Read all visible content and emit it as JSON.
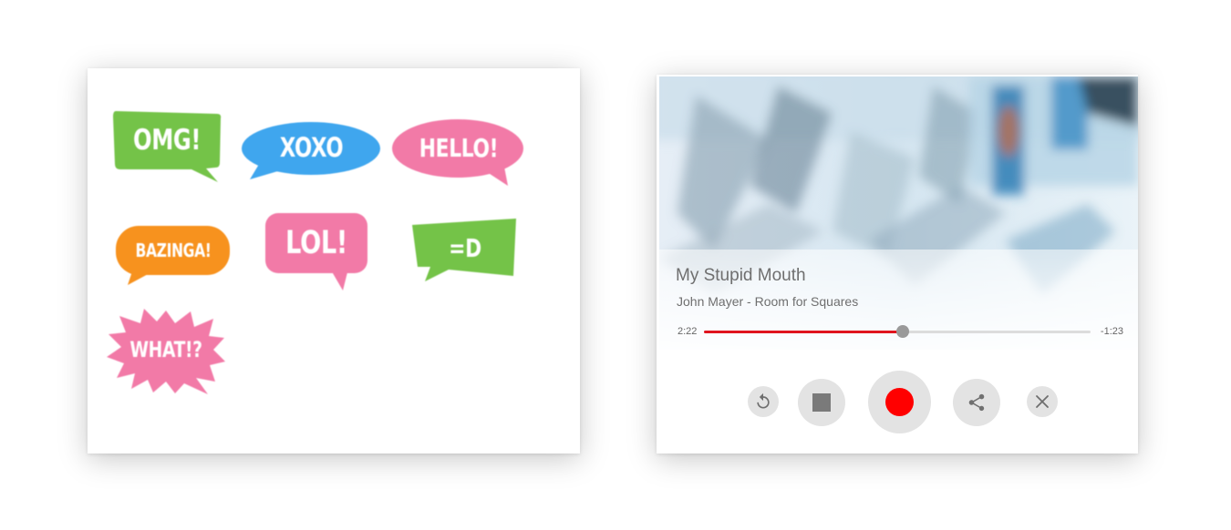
{
  "stickers": [
    {
      "label": "OMG!",
      "color": "#74c348"
    },
    {
      "label": "XOXO",
      "color": "#3fa6ee"
    },
    {
      "label": "HELLO!",
      "color": "#f27aa7"
    },
    {
      "label": "BAZINGA!",
      "color": "#f7921e"
    },
    {
      "label": "LOL!",
      "color": "#f27aa7"
    },
    {
      "label": "=D",
      "color": "#74c348"
    },
    {
      "label": "WHAT!?",
      "color": "#f27aa7"
    }
  ],
  "player": {
    "title": "My Stupid Mouth",
    "artist_album": "John Mayer - Room for Squares",
    "elapsed": "2:22",
    "remaining": "-1:23",
    "progress_fraction": 0.514,
    "accent_color": "#e0141e",
    "record_color": "#ff0000",
    "controls": {
      "replay": "replay-icon",
      "stop": "stop-icon",
      "record": "record-icon",
      "share": "share-icon",
      "close": "close-icon"
    }
  }
}
